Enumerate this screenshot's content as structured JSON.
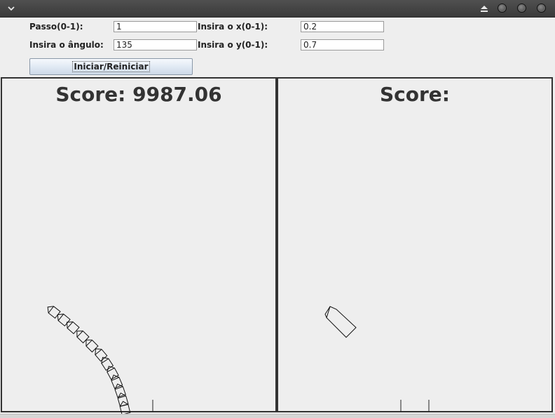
{
  "window": {
    "menu_icon": "chevron-down-icon",
    "eject_icon": "eject-icon",
    "control_icons": [
      "minimize-circle-icon",
      "maximize-circle-icon",
      "close-circle-icon"
    ]
  },
  "form": {
    "step_label": "Passo(0-1):",
    "step_value": "1",
    "angle_label": "Insira o ângulo:",
    "angle_value": "135",
    "x_label": "Insira o x(0-1):",
    "x_value": "0.2",
    "y_label": "Insira o y(0-1):",
    "y_value": "0.7",
    "start_button": "Iniciar/Reiniciar"
  },
  "panels": [
    {
      "score_label": "Score: 9987.06"
    },
    {
      "score_label": "Score:"
    }
  ]
}
